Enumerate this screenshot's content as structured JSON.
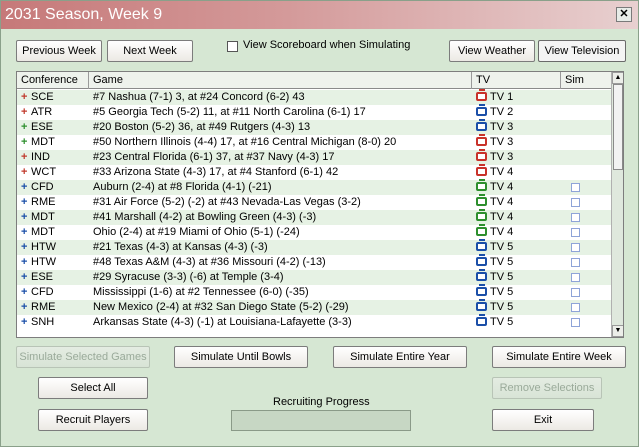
{
  "window": {
    "title": "2031 Season, Week 9",
    "close_glyph": "✕"
  },
  "top_buttons": {
    "previous_week": "Previous Week",
    "next_week": "Next Week",
    "view_weather": "View Weather",
    "view_television": "View Television"
  },
  "scoreboard_checkbox": {
    "label": "View Scoreboard when Simulating",
    "checked": false
  },
  "grid": {
    "columns": [
      "Conference",
      "Game",
      "TV",
      "Sim"
    ],
    "rows": [
      {
        "conf": "SCE",
        "sign": "+",
        "sign_color": "#c0392b",
        "game": "#7 Nashua (7-1) 3,  at  #24 Concord (6-2) 43",
        "tv": "TV 1",
        "tv_color": "red",
        "sim": false
      },
      {
        "conf": "ATR",
        "sign": "+",
        "sign_color": "#c0392b",
        "game": "#5 Georgia Tech (5-2) 11,  at  #11 North Carolina (6-1) 17",
        "tv": "TV 2",
        "tv_color": "blue",
        "sim": false
      },
      {
        "conf": "ESE",
        "sign": "+",
        "sign_color": "#2d8f2d",
        "game": "#20 Boston (5-2) 36,  at  #49 Rutgers (4-3) 13",
        "tv": "TV 3",
        "tv_color": "blue",
        "sim": false
      },
      {
        "conf": "MDT",
        "sign": "+",
        "sign_color": "#2d8f2d",
        "game": "#50 Northern Illinois (4-4) 17,  at  #16 Central Michigan (8-0) 20",
        "tv": "TV 3",
        "tv_color": "red",
        "sim": false
      },
      {
        "conf": "IND",
        "sign": "+",
        "sign_color": "#c0392b",
        "game": "#23 Central Florida (6-1) 37,  at  #37 Navy (4-3) 17",
        "tv": "TV 3",
        "tv_color": "red",
        "sim": false
      },
      {
        "conf": "WCT",
        "sign": "+",
        "sign_color": "#c0392b",
        "game": "#33 Arizona State (4-3) 17,  at  #4 Stanford (6-1) 42",
        "tv": "TV 4",
        "tv_color": "red",
        "sim": false
      },
      {
        "conf": "CFD",
        "sign": "+",
        "sign_color": "#1b4fa8",
        "game": "Auburn (2-4) at  #8 Florida (4-1) (-21)",
        "tv": "TV 4",
        "tv_color": "green",
        "sim": true
      },
      {
        "conf": "RME",
        "sign": "+",
        "sign_color": "#1b4fa8",
        "game": "#31 Air Force (5-2) (-2) at  #43 Nevada-Las Vegas (3-2)",
        "tv": "TV 4",
        "tv_color": "green",
        "sim": true
      },
      {
        "conf": "MDT",
        "sign": "+",
        "sign_color": "#1b4fa8",
        "game": "#41 Marshall (4-2) at Bowling Green (4-3) (-3)",
        "tv": "TV 4",
        "tv_color": "green",
        "sim": true
      },
      {
        "conf": "MDT",
        "sign": "+",
        "sign_color": "#1b4fa8",
        "game": "Ohio (2-4) at  #19 Miami of Ohio (5-1) (-24)",
        "tv": "TV 4",
        "tv_color": "green",
        "sim": true
      },
      {
        "conf": "HTW",
        "sign": "+",
        "sign_color": "#1b4fa8",
        "game": "#21 Texas (4-3) at Kansas (4-3) (-3)",
        "tv": "TV 5",
        "tv_color": "blue",
        "sim": true
      },
      {
        "conf": "HTW",
        "sign": "+",
        "sign_color": "#1b4fa8",
        "game": "#48 Texas A&M (4-3) at  #36 Missouri (4-2) (-13)",
        "tv": "TV 5",
        "tv_color": "blue",
        "sim": true
      },
      {
        "conf": "ESE",
        "sign": "+",
        "sign_color": "#1b4fa8",
        "game": "#29 Syracuse (3-3) (-6) at Temple (3-4)",
        "tv": "TV 5",
        "tv_color": "blue",
        "sim": true
      },
      {
        "conf": "CFD",
        "sign": "+",
        "sign_color": "#1b4fa8",
        "game": "Mississippi (1-6) at  #2 Tennessee (6-0) (-35)",
        "tv": "TV 5",
        "tv_color": "blue",
        "sim": true
      },
      {
        "conf": "RME",
        "sign": "+",
        "sign_color": "#1b4fa8",
        "game": "New Mexico (2-4) at  #32 San Diego State (5-2) (-29)",
        "tv": "TV 5",
        "tv_color": "blue",
        "sim": true
      },
      {
        "conf": "SNH",
        "sign": "+",
        "sign_color": "#1b4fa8",
        "game": "Arkansas State (4-3) (-1) at Louisiana-Lafayette (3-3)",
        "tv": "TV 5",
        "tv_color": "blue",
        "sim": true
      }
    ]
  },
  "bottom_buttons": {
    "simulate_selected": "Simulate Selected Games",
    "simulate_until_bowls": "Simulate Until Bowls",
    "simulate_entire_year": "Simulate Entire Year",
    "simulate_entire_week": "Simulate Entire Week",
    "select_all": "Select All",
    "remove_selections": "Remove Selections",
    "recruit_players": "Recruit Players",
    "exit": "Exit"
  },
  "recruiting": {
    "label": "Recruiting Progress",
    "progress": 0
  }
}
